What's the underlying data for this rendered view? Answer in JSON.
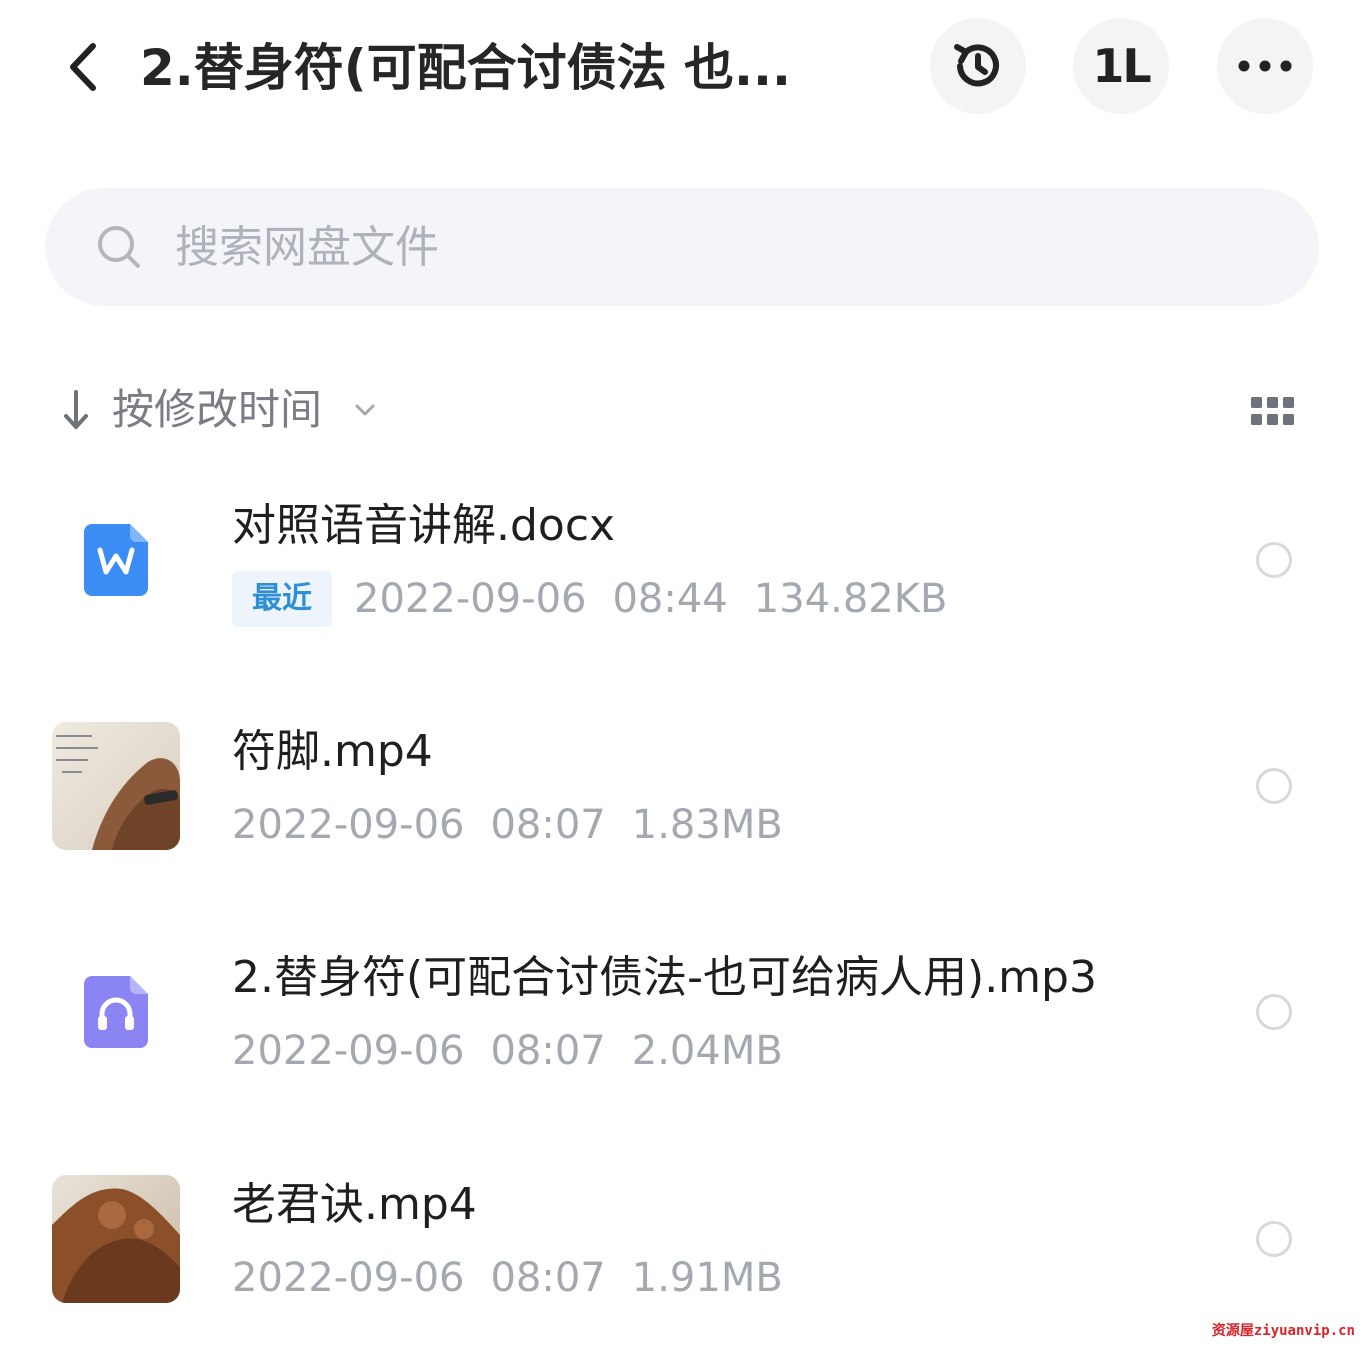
{
  "header": {
    "title": "2.替身符(可配合讨债法 也...",
    "history_icon": "history-icon",
    "sort_icon": "sort-swap-icon",
    "sort_symbol": "1L",
    "more_icon": "more-horizontal-icon"
  },
  "search": {
    "placeholder": "搜索网盘文件"
  },
  "sortbar": {
    "label": "按修改时间"
  },
  "files": [
    {
      "name": "对照语音讲解.docx",
      "type": "docx",
      "badge": "最近",
      "date": "2022-09-06",
      "time": "08:44",
      "size": "134.82KB"
    },
    {
      "name": "符脚.mp4",
      "type": "video",
      "date": "2022-09-06",
      "time": "08:07",
      "size": "1.83MB"
    },
    {
      "name": "2.替身符(可配合讨债法-也可给病人用).mp3",
      "type": "audio",
      "date": "2022-09-06",
      "time": "08:07",
      "size": "2.04MB"
    },
    {
      "name": "老君诀.mp4",
      "type": "video",
      "date": "2022-09-06",
      "time": "08:07",
      "size": "1.91MB"
    }
  ],
  "watermark": "资源屋ziyuanvip.cn",
  "colors": {
    "accent": "#2e8fd6",
    "doc_icon": "#3b8cf5",
    "audio_icon": "#8a85f2",
    "meta_text": "#a4a8b0"
  }
}
